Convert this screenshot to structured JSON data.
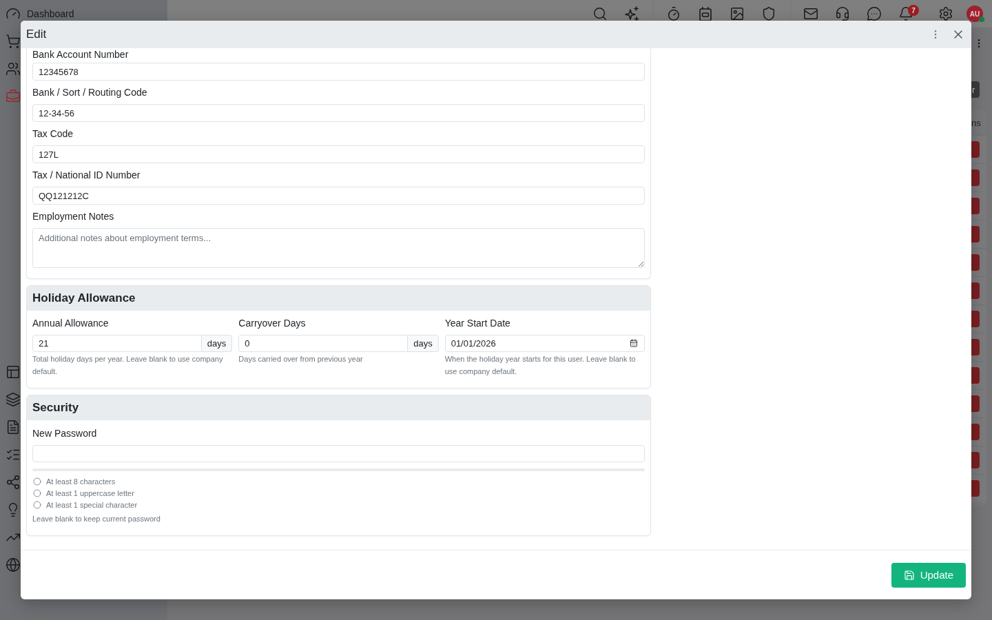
{
  "app": {
    "sidebar": {
      "items": [
        {
          "label": "Dashboard",
          "selected": false
        },
        {
          "selected": false
        },
        {
          "selected": false
        },
        {
          "selected": true
        }
      ],
      "lower_items": [
        {
          "selected": false
        },
        {
          "selected": false
        },
        {
          "selected": false
        },
        {
          "selected": false
        },
        {
          "selected": false
        },
        {
          "selected": false
        },
        {
          "selected": false
        },
        {
          "selected": false
        }
      ]
    },
    "topbar": {
      "notification_count": "7",
      "avatar": {
        "initials": "AU",
        "online": true
      }
    },
    "content": {
      "toolbar_button": "r",
      "table_header": "ns"
    }
  },
  "modal": {
    "title": "Edit",
    "employment": {
      "fields": [
        {
          "kind": "text",
          "label": "Bank Account Number",
          "value": "12345678"
        },
        {
          "kind": "text",
          "label": "Bank / Sort / Routing Code",
          "value": "12-34-56"
        },
        {
          "kind": "text",
          "label": "Tax Code",
          "value": "127L"
        },
        {
          "kind": "text",
          "label": "Tax / National ID Number",
          "value": "QQ121212C"
        },
        {
          "kind": "textarea",
          "label": "Employment Notes",
          "placeholder": "Additional notes about employment terms..."
        }
      ]
    },
    "holiday": {
      "title": "Holiday Allowance",
      "fields": [
        {
          "kind": "number",
          "label": "Annual Allowance",
          "value": "21",
          "unit": "days",
          "help": "Total holiday days per year. Leave blank to use company default."
        },
        {
          "kind": "number",
          "label": "Carryover Days",
          "value": "0",
          "unit": "days",
          "help": "Days carried over from previous year"
        },
        {
          "kind": "date",
          "label": "Year Start Date",
          "value": "01/01/2026",
          "help": "When the holiday year starts for this user. Leave blank to use company default."
        }
      ]
    },
    "security": {
      "title": "Security",
      "fields": [
        {
          "kind": "password",
          "label": "New Password"
        }
      ],
      "requirements": [
        {
          "text": "At least 8 characters",
          "met": false
        },
        {
          "text": "At least 1 uppercase letter",
          "met": false
        },
        {
          "text": "At least 1 special character",
          "met": false
        }
      ],
      "help": "Leave blank to keep current password"
    },
    "footer": {
      "submit_button": "Update"
    }
  }
}
